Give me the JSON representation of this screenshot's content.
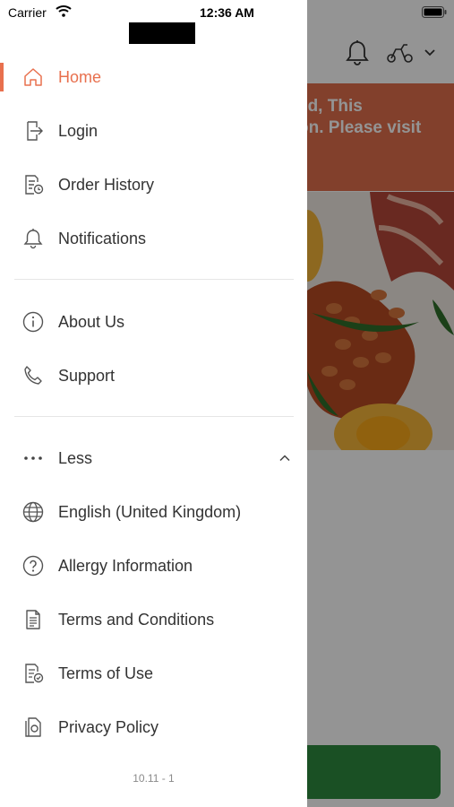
{
  "status_bar": {
    "carrier": "Carrier",
    "time": "12:36 AM"
  },
  "background": {
    "banner_text": "ed, This\non. Please visit\n/"
  },
  "menu": {
    "primary": [
      {
        "label": "Home",
        "icon": "home-icon",
        "active": true
      },
      {
        "label": "Login",
        "icon": "login-icon"
      },
      {
        "label": "Order History",
        "icon": "order-history-icon"
      },
      {
        "label": "Notifications",
        "icon": "bell-icon"
      }
    ],
    "secondary": [
      {
        "label": "About Us",
        "icon": "info-icon"
      },
      {
        "label": "Support",
        "icon": "phone-icon"
      }
    ],
    "more_toggle": {
      "label": "Less",
      "icon": "more-dots-icon"
    },
    "extra": [
      {
        "label": "English (United Kingdom)",
        "icon": "globe-icon"
      },
      {
        "label": "Allergy Information",
        "icon": "question-icon"
      },
      {
        "label": "Terms and Conditions",
        "icon": "document-icon"
      },
      {
        "label": "Terms of Use",
        "icon": "document-check-icon"
      },
      {
        "label": "Privacy Policy",
        "icon": "privacy-icon"
      }
    ]
  },
  "version": "10.11 - 1",
  "colors": {
    "accent": "#e8704e",
    "text": "#333333",
    "banner": "#e06e4c",
    "cta": "#2e8b3e"
  }
}
